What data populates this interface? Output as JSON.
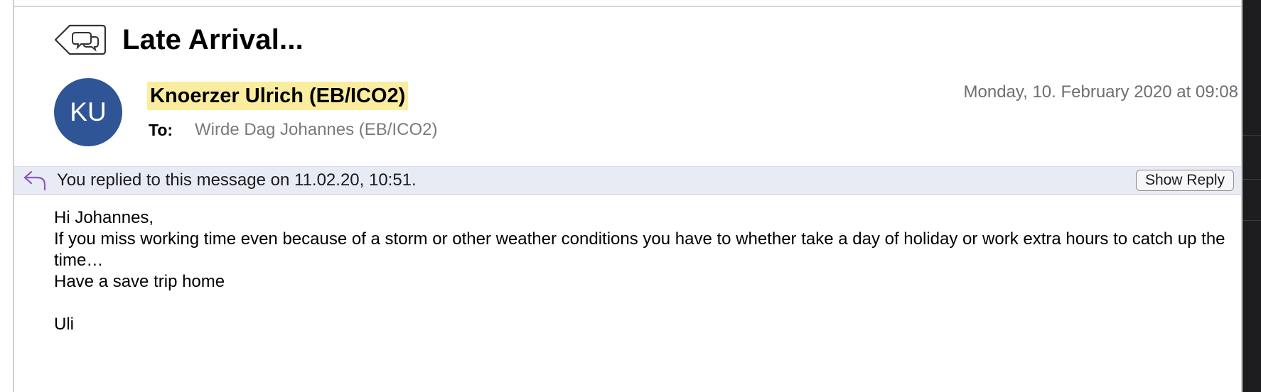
{
  "message": {
    "subject": "Late Arrival...",
    "avatar_initials": "KU",
    "avatar_color": "#2f5597",
    "sender": "Knoerzer Ulrich (EB/ICO2)",
    "sender_highlight_color": "#fbed9f",
    "date": "Monday, 10. February 2020 at 09:08",
    "to_label": "To:",
    "to_value": "Wirde Dag Johannes (EB/ICO2)"
  },
  "reply_banner": {
    "icon": "reply-arrow-icon",
    "text": "You replied to this message on 11.02.20, 10:51.",
    "button_label": "Show Reply",
    "background_color": "#e8ebf4"
  },
  "body": {
    "greeting": "Hi Johannes,",
    "paragraph": "If you miss working time even because of a storm or other weather conditions you have to whether take a day of holiday or work extra hours to catch up the time…",
    "closing": "Have a save trip home",
    "signature": "Uli"
  },
  "icons": {
    "conversation": "conversation-bubbles-icon"
  }
}
